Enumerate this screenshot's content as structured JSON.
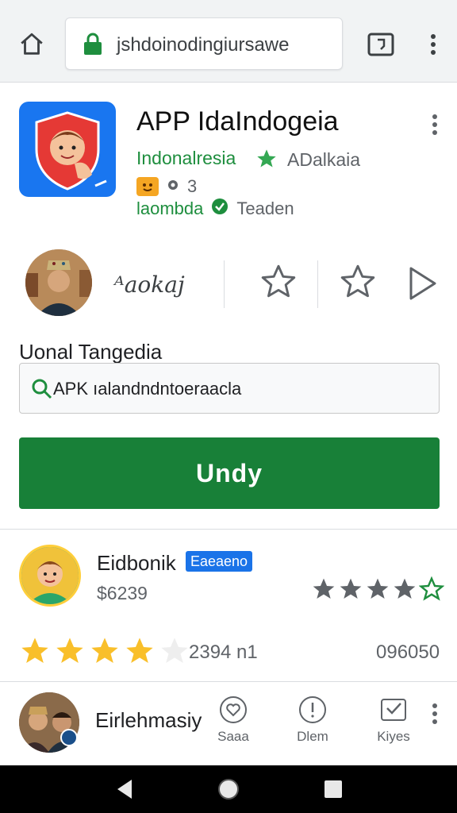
{
  "browser": {
    "url": "jshdoinodingiursawe",
    "home_icon": "home-icon",
    "lock_icon": "lock-icon",
    "tabs_icon": "tabs-icon",
    "menu_icon": "more-vert-icon"
  },
  "app": {
    "title": "APP IdaIndogeia",
    "developer": "Indonalresia",
    "category": "ADalkaia",
    "badge_text": "3",
    "tag_primary": "laombda",
    "tag_secondary": "Teaden"
  },
  "creator": {
    "name": "ᴬaokaj"
  },
  "search": {
    "label": "Uonal Tangedia",
    "value": "APK ıalandndntoeraacla"
  },
  "install": {
    "label": "Undy"
  },
  "review": {
    "name": "Eidbonik",
    "badge": "Eaeaeno",
    "price": "$6239",
    "stars_filled": 4,
    "rating_count": "2394 n1",
    "rating_number": "096050",
    "rating_stars_filled": 4,
    "rating_stars_total": 5
  },
  "bottom": {
    "name": "Eirlehmasiy",
    "actions": [
      {
        "label": "Saaa",
        "icon": "heart-circle-icon"
      },
      {
        "label": "Dlem",
        "icon": "info-circle-icon"
      },
      {
        "label": "Kiyes",
        "icon": "check-box-icon"
      }
    ]
  },
  "colors": {
    "accent_green": "#188038",
    "link_green": "#1e8e3e",
    "star_gold": "#f9bf2a",
    "badge_blue": "#1a73e8"
  }
}
